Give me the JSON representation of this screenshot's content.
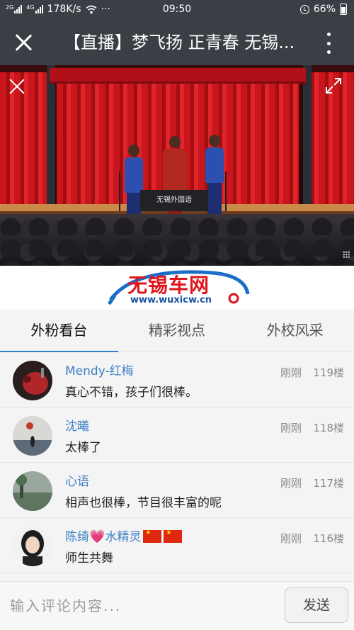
{
  "status_bar": {
    "network_label_1": "2G",
    "network_label_2": "4G",
    "speed": "178K/s",
    "dots": "···",
    "time": "09:50",
    "battery": "66%"
  },
  "header": {
    "title": "【直播】梦飞扬 正青春 无锡..."
  },
  "video": {
    "desk_text": "无锡外国语"
  },
  "logo": {
    "text": "无锡车网",
    "url": "www.wuxicw.cn"
  },
  "tabs": [
    {
      "label": "外粉看台",
      "active": true
    },
    {
      "label": "精彩视点",
      "active": false
    },
    {
      "label": "外校风采",
      "active": false
    }
  ],
  "comments": [
    {
      "name": "Mendy-红梅",
      "text": "真心不错，孩子们很棒。",
      "time": "刚刚",
      "floor": "119楼"
    },
    {
      "name": "沈曦",
      "text": "太棒了",
      "time": "刚刚",
      "floor": "118楼"
    },
    {
      "name": "心语",
      "text": "相声也很棒，节目很丰富的呢",
      "time": "刚刚",
      "floor": "117楼"
    },
    {
      "name_part1": "陈绮",
      "name_part2": "水精灵",
      "text": "师生共舞",
      "time": "刚刚",
      "floor": "116楼"
    }
  ],
  "input": {
    "placeholder": "输入评论内容...",
    "send_label": "发送"
  },
  "colors": {
    "header_bg": "#3b3f45",
    "name_blue": "#3d7fc6",
    "tab_indicator": "#2a7fd4",
    "logo_red": "#e0151b",
    "logo_blue": "#1a54a3"
  }
}
